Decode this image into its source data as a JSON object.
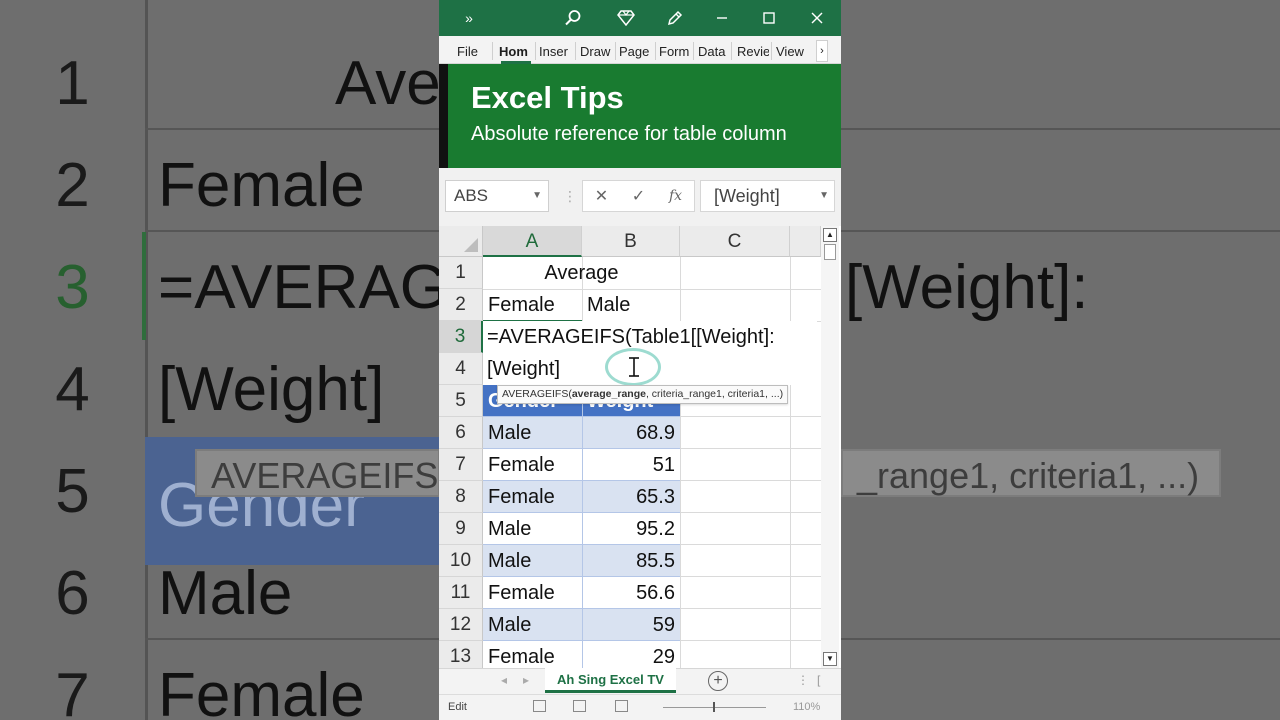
{
  "background_zoom": {
    "rows": [
      {
        "num": "1",
        "text": "Ave"
      },
      {
        "num": "2",
        "text": "Female"
      },
      {
        "num": "3",
        "text": "=AVERAG",
        "right": "[Weight]:"
      },
      {
        "num": "4",
        "text": "[Weight]"
      },
      {
        "num": "5",
        "text": "Gender"
      },
      {
        "num": "6",
        "text": "Male"
      },
      {
        "num": "7",
        "text": "Female"
      }
    ],
    "tooltip_left": "AVERAGEIFS(",
    "tooltip_right": "_range1, criteria1, ...)"
  },
  "titlebar": {
    "more": "»",
    "icons": [
      "search-icon",
      "diamond-icon",
      "pen-icon",
      "minimize-icon",
      "maximize-icon",
      "close-icon"
    ]
  },
  "ribbon": {
    "tabs": [
      "File",
      "Hom",
      "Inser",
      "Draw",
      "Page",
      "Form",
      "Data",
      "Revie",
      "View"
    ],
    "active": "Hom",
    "more": "›"
  },
  "banner": {
    "title": "Excel Tips",
    "subtitle": "Absolute reference for table column"
  },
  "formula_bar": {
    "name_box": "ABS",
    "cancel": "✕",
    "enter": "✓",
    "fx": "fx",
    "value": "[Weight]"
  },
  "columns": [
    "A",
    "B",
    "C"
  ],
  "rows": [
    {
      "num": "1",
      "a": "",
      "b": "",
      "merged": "Average"
    },
    {
      "num": "2",
      "a": "Female",
      "b": "Male"
    },
    {
      "num": "3",
      "a": "",
      "b": ""
    },
    {
      "num": "4",
      "a": "",
      "b": ""
    },
    {
      "num": "5",
      "a": "Gender",
      "b": "Weight"
    },
    {
      "num": "6",
      "a": "Male",
      "b": "68.9"
    },
    {
      "num": "7",
      "a": "Female",
      "b": "51"
    },
    {
      "num": "8",
      "a": "Female",
      "b": "65.3"
    },
    {
      "num": "9",
      "a": "Male",
      "b": "95.2"
    },
    {
      "num": "10",
      "a": "Male",
      "b": "85.5"
    },
    {
      "num": "11",
      "a": "Female",
      "b": "56.6"
    },
    {
      "num": "12",
      "a": "Male",
      "b": "59"
    },
    {
      "num": "13",
      "a": "Female",
      "b": "29"
    }
  ],
  "editing": {
    "line1": "=AVERAGEIFS(Table1[[Weight]:",
    "line2": "[Weight]"
  },
  "tooltip": {
    "fn": "AVERAGEIFS(",
    "bold_arg": "average_range",
    "rest": ", criteria_range1, criteria1, ...)"
  },
  "sheet_tab": "Ah Sing Excel TV",
  "add_sheet": "+",
  "status": {
    "mode": "Edit",
    "zoom": "110%"
  },
  "colors": {
    "excel_green": "#1e7145",
    "banner_green": "#197b30",
    "table_header": "#4472c4",
    "table_band": "#d9e2f1"
  }
}
